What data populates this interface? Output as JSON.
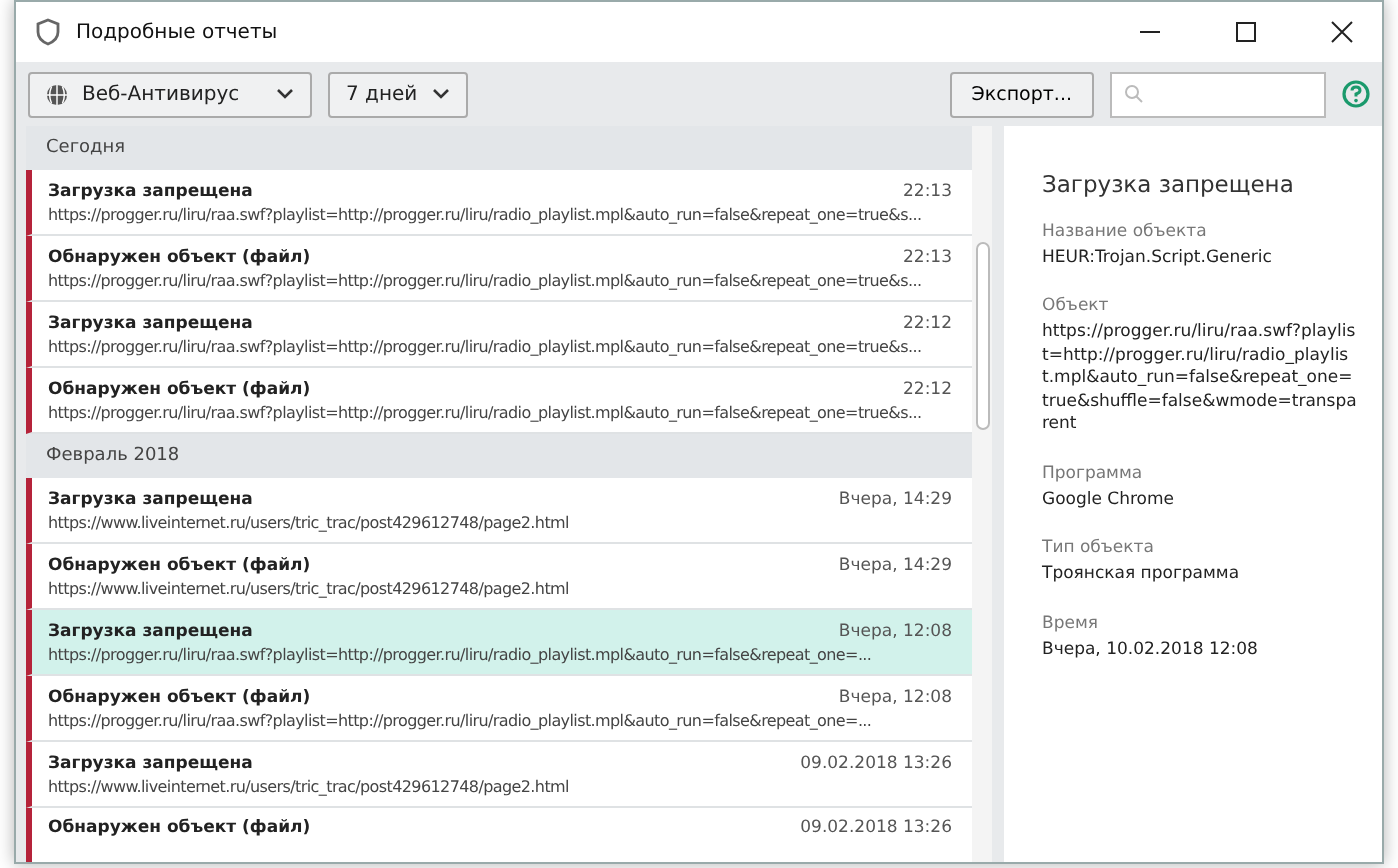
{
  "window": {
    "title": "Подробные отчеты"
  },
  "toolbar": {
    "component": "Веб-Антивирус",
    "period": "7 дней",
    "export": "Экспорт..."
  },
  "groups": [
    {
      "label": "Сегодня",
      "events": [
        {
          "title": "Загрузка запрещена",
          "url": "https://progger.ru/liru/raa.swf?playlist=http://progger.ru/liru/radio_playlist.mpl&auto_run=false&repeat_one=true&s...",
          "time": "22:13",
          "selected": false
        },
        {
          "title": "Обнаружен объект (файл)",
          "url": "https://progger.ru/liru/raa.swf?playlist=http://progger.ru/liru/radio_playlist.mpl&auto_run=false&repeat_one=true&s...",
          "time": "22:13",
          "selected": false
        },
        {
          "title": "Загрузка запрещена",
          "url": "https://progger.ru/liru/raa.swf?playlist=http://progger.ru/liru/radio_playlist.mpl&auto_run=false&repeat_one=true&s...",
          "time": "22:12",
          "selected": false
        },
        {
          "title": "Обнаружен объект (файл)",
          "url": "https://progger.ru/liru/raa.swf?playlist=http://progger.ru/liru/radio_playlist.mpl&auto_run=false&repeat_one=true&s...",
          "time": "22:12",
          "selected": false
        }
      ]
    },
    {
      "label": "Февраль 2018",
      "events": [
        {
          "title": "Загрузка запрещена",
          "url": "https://www.liveinternet.ru/users/tric_trac/post429612748/page2.html",
          "time": "Вчера, 14:29",
          "selected": false
        },
        {
          "title": "Обнаружен объект (файл)",
          "url": "https://www.liveinternet.ru/users/tric_trac/post429612748/page2.html",
          "time": "Вчера, 14:29",
          "selected": false
        },
        {
          "title": "Загрузка запрещена",
          "url": "https://progger.ru/liru/raa.swf?playlist=http://progger.ru/liru/radio_playlist.mpl&auto_run=false&repeat_one=...",
          "time": "Вчера, 12:08",
          "selected": true
        },
        {
          "title": "Обнаружен объект (файл)",
          "url": "https://progger.ru/liru/raa.swf?playlist=http://progger.ru/liru/radio_playlist.mpl&auto_run=false&repeat_one=...",
          "time": "Вчера, 12:08",
          "selected": false
        },
        {
          "title": "Загрузка запрещена",
          "url": "https://www.liveinternet.ru/users/tric_trac/post429612748/page2.html",
          "time": "09.02.2018 13:26",
          "selected": false
        },
        {
          "title": "Обнаружен объект (файл)",
          "time": "09.02.2018 13:26",
          "selected": false
        }
      ]
    }
  ],
  "details": {
    "title": "Загрузка запрещена",
    "fields": [
      {
        "label": "Название объекта",
        "value": "HEUR:Trojan.Script.Generic"
      },
      {
        "label": "Объект",
        "value": "https://progger.ru/liru/raa.swf?playlist=http://progger.ru/liru/radio_playlist.mpl&auto_run=false&repeat_one=true&shuffle=false&wmode=transparent"
      },
      {
        "label": "Программа",
        "value": "Google Chrome"
      },
      {
        "label": "Тип объекта",
        "value": "Троянская программа"
      },
      {
        "label": "Время",
        "value": "Вчера, 10.02.2018 12:08"
      }
    ]
  }
}
